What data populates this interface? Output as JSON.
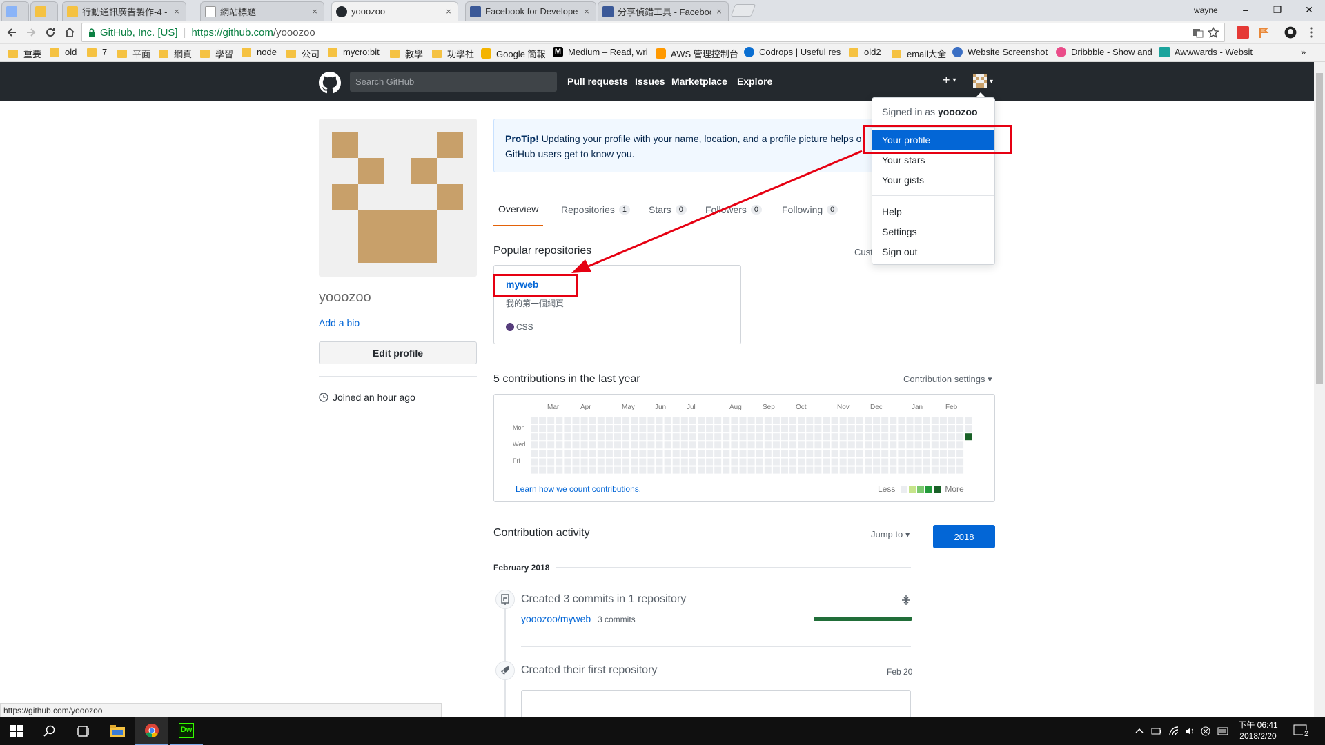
{
  "browser": {
    "tabs": [
      {
        "label": "",
        "favicon_color": "#8ab4f8"
      },
      {
        "label": "",
        "favicon_color": "#f5c242"
      },
      {
        "label": "行動通訊廣告製作-4 - G",
        "favicon_color": "#f5c242"
      },
      {
        "label": "網站標題",
        "favicon_color": "#ffffff"
      },
      {
        "label": "yooozoo",
        "favicon_color": "#24292e"
      },
      {
        "label": "Facebook for Develope",
        "favicon_color": "#3b5998"
      },
      {
        "label": "分享偵錯工具 - Faceboo",
        "favicon_color": "#3b5998"
      }
    ],
    "close_glyph": "×",
    "window_user": "wayne",
    "window_buttons": [
      "–",
      "❐",
      "✕"
    ],
    "address": {
      "org": "GitHub, Inc. [US]",
      "url_host": "https://github.com",
      "url_path": "/yooozoo"
    },
    "bookmarks": [
      {
        "label": "重要",
        "type": "folder"
      },
      {
        "label": "old",
        "type": "folder"
      },
      {
        "label": "7",
        "type": "folder"
      },
      {
        "label": "平面",
        "type": "folder"
      },
      {
        "label": "網頁",
        "type": "folder"
      },
      {
        "label": "學習",
        "type": "folder"
      },
      {
        "label": "node",
        "type": "folder"
      },
      {
        "label": "公司",
        "type": "folder"
      },
      {
        "label": "mycro:bit",
        "type": "folder"
      },
      {
        "label": "教學",
        "type": "folder"
      },
      {
        "label": "功學社",
        "type": "folder"
      },
      {
        "label": "Google 簡報",
        "type": "site",
        "color": "#f4b400"
      },
      {
        "label": "Medium – Read, wri",
        "type": "site",
        "color": "#000000"
      },
      {
        "label": "AWS 管理控制台",
        "type": "site",
        "color": "#ff9900"
      },
      {
        "label": "Codrops | Useful res",
        "type": "site",
        "color": "#0a6ed1"
      },
      {
        "label": "old2",
        "type": "folder"
      },
      {
        "label": "email大全",
        "type": "folder"
      },
      {
        "label": "Website Screenshot",
        "type": "site",
        "color": "#3b6fc4"
      },
      {
        "label": "Dribbble - Show and",
        "type": "site",
        "color": "#ea4c89"
      },
      {
        "label": "Awwwards - Websit",
        "type": "site",
        "color": "#1ba39c"
      }
    ],
    "bookmarks_overflow": "»",
    "status_url": "https://github.com/yooozoo"
  },
  "github": {
    "search_placeholder": "Search GitHub",
    "nav": [
      "Pull requests",
      "Issues",
      "Marketplace",
      "Explore"
    ],
    "plus_glyph": "+",
    "caret": "▾",
    "dropdown": {
      "signed_in_prefix": "Signed in as",
      "signed_in_user": "yooozoo",
      "items_group1": [
        "Your profile",
        "Your stars",
        "Your gists"
      ],
      "items_group2": [
        "Help",
        "Settings",
        "Sign out"
      ]
    }
  },
  "profile": {
    "username": "yooozoo",
    "add_bio": "Add a bio",
    "edit_profile": "Edit profile",
    "joined": "Joined an hour ago",
    "avatar_color": "#c8a06a",
    "protip_label": "ProTip!",
    "protip_text": " Updating your profile with your name, location, and a profile picture helps o",
    "protip_text2": "GitHub users get to know you."
  },
  "tabs": [
    {
      "label": "Overview",
      "count": null
    },
    {
      "label": "Repositories",
      "count": "1"
    },
    {
      "label": "Stars",
      "count": "0"
    },
    {
      "label": "Followers",
      "count": "0"
    },
    {
      "label": "Following",
      "count": "0"
    }
  ],
  "popular": {
    "title": "Popular repositories",
    "customize": "Cust",
    "repo": {
      "name": "myweb",
      "description": "我的第一個網頁",
      "language": "CSS",
      "language_color": "#563d7c"
    }
  },
  "contributions": {
    "title": "5 contributions in the last year",
    "settings": "Contribution settings ▾",
    "months": [
      "Mar",
      "Apr",
      "May",
      "Jun",
      "Jul",
      "Aug",
      "Sep",
      "Oct",
      "Nov",
      "Dec",
      "Jan",
      "Feb"
    ],
    "days": [
      "Mon",
      "Wed",
      "Fri"
    ],
    "learn": "Learn how we count contributions.",
    "less": "Less",
    "more": "More",
    "scale_colors": [
      "#ebedf0",
      "#c6e48b",
      "#7bc96f",
      "#239a3b",
      "#196127"
    ],
    "active_cell": {
      "date_label": "Feb",
      "weekday": "Tue",
      "level": 4
    }
  },
  "activity": {
    "title": "Contribution activity",
    "jump_to": "Jump to ▾",
    "year": "2018",
    "month": "February 2018",
    "commits_title": "Created 3 commits in 1 repository",
    "commit_repo": "yooozoo/myweb",
    "commit_count": "3 commits",
    "commit_fraction": 1.0,
    "first_repo_title": "Created their first repository",
    "first_repo_date": "Feb 20"
  },
  "taskbar": {
    "time": "下午 06:41",
    "date": "2018/2/20",
    "notification_count": "2"
  },
  "annotation_color": "#e60012"
}
